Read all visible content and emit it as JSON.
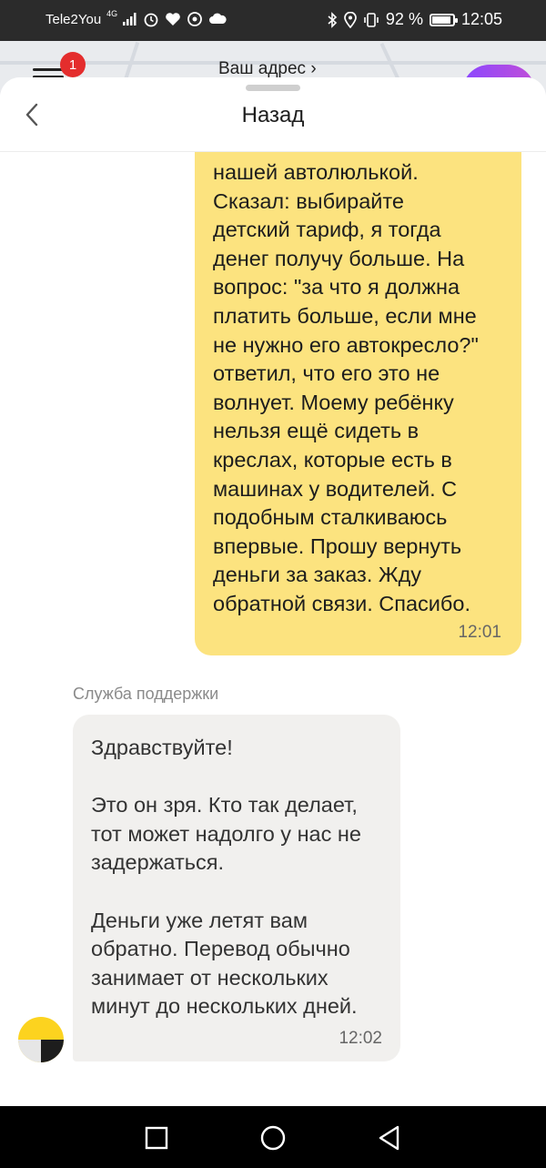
{
  "status_bar": {
    "carrier": "Tele2You",
    "network": "4G",
    "battery": "92 %",
    "battery_level": 0.92,
    "time": "12:05"
  },
  "background": {
    "notification_count": "1",
    "address": "Ваш адрес ›"
  },
  "header": {
    "title": "Назад",
    "back_icon": "chevron-left"
  },
  "messages": {
    "user": {
      "text": "нашей автолюлькой.\nСказал: выбирайте\nдетский тариф, я тогда\nденег получу больше. На\nвопрос: \"за что я должна\nплатить больше, если мне\nне нужно его автокресло?\"\nответил, что его это не\nволнует. Моему ребёнку\nнельзя ещё сидеть в\nкреслах, которые есть в\nмашинах у водителей. С\nподобным сталкиваюсь\nвпервые. Прошу вернуть\nденьги за заказ. Жду\nобратной связи. Спасибо.",
      "time": "12:01"
    },
    "support": {
      "label": "Служба поддержки",
      "text": "Здравствуйте!\n\nЭто он зря. Кто так делает,\nтот может надолго у нас не\nзадержаться.\n\nДеньги уже летят вам\nобратно. Перевод обычно\nзанимает от нескольких\nминут до нескольких дней.",
      "time": "12:02"
    }
  },
  "nav": {
    "icons": [
      "recent-apps",
      "home",
      "back"
    ]
  },
  "colors": {
    "user_bubble": "#fce37f",
    "support_bubble": "#f1f0ee",
    "badge": "#e42d2d",
    "avatar_yellow": "#fcd31f"
  }
}
